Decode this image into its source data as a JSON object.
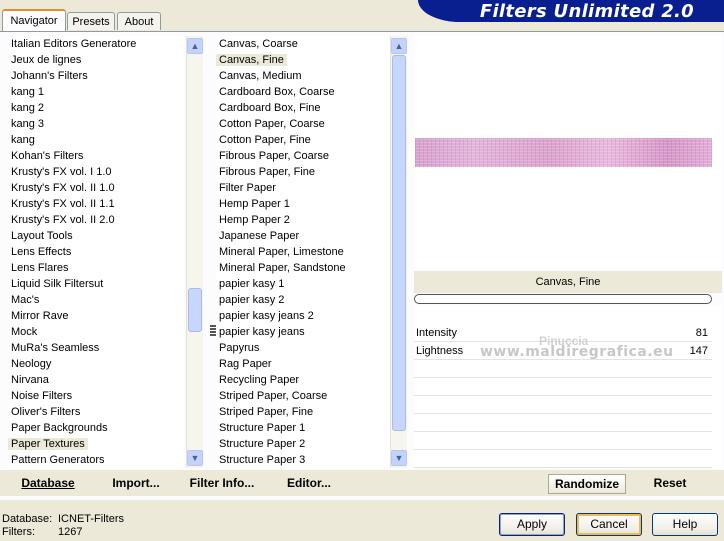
{
  "tabs": [
    {
      "label": "Navigator"
    },
    {
      "label": "Presets"
    },
    {
      "label": "About"
    }
  ],
  "banner": {
    "title": "Filters Unlimited 2.0"
  },
  "categories": {
    "items": [
      "Italian Editors Generatore",
      "Jeux de lignes",
      "Johann's Filters",
      "kang 1",
      "kang 2",
      "kang 3",
      "kang",
      "Kohan's Filters",
      "Krusty's FX vol. I 1.0",
      "Krusty's FX vol. II 1.0",
      "Krusty's FX vol. II 1.1",
      "Krusty's FX vol. II 2.0",
      "Layout Tools",
      "Lens Effects",
      "Lens Flares",
      "Liquid Silk Filtersut",
      "Mac's",
      "Mirror Rave",
      "Mock",
      "MuRa's Seamless",
      "Neology",
      "Nirvana",
      "Noise Filters",
      "Oliver's Filters",
      "Paper Backgrounds",
      "Paper Textures",
      "Pattern Generators"
    ],
    "selected_index": 25
  },
  "filters": {
    "items": [
      "Canvas, Coarse",
      "Canvas, Fine",
      "Canvas, Medium",
      "Cardboard Box, Coarse",
      "Cardboard Box, Fine",
      "Cotton Paper, Coarse",
      "Cotton Paper, Fine",
      "Fibrous Paper, Coarse",
      "Fibrous Paper, Fine",
      "Filter Paper",
      "Hemp Paper 1",
      "Hemp Paper 2",
      "Japanese Paper",
      "Mineral Paper, Limestone",
      "Mineral Paper, Sandstone",
      "papier kasy 1",
      "papier kasy 2",
      "papier kasy jeans 2",
      "papier kasy jeans",
      "Papyrus",
      "Rag Paper",
      "Recycling Paper",
      "Striped Paper, Coarse",
      "Striped Paper, Fine",
      "Structure Paper 1",
      "Structure Paper 2",
      "Structure Paper 3"
    ],
    "selected_index": 1
  },
  "toolbar": {
    "database": "Database",
    "import_pre": "Import...",
    "filter_info": "Filter Info...",
    "editor": "Editor...",
    "randomize": "Randomize",
    "reset": "Reset"
  },
  "preview": {
    "filter_name": "Canvas, Fine",
    "progress": 0
  },
  "params": [
    {
      "name": "Intensity",
      "value": "81"
    },
    {
      "name": "Lightness",
      "value": "147"
    }
  ],
  "watermark": {
    "line1": "Pinuccia",
    "line2": "www.maldiregrafica.eu"
  },
  "footer": {
    "database_label": "Database:",
    "database_value": "ICNET-Filters",
    "filters_label": "Filters:",
    "filters_value": "1267",
    "apply": "Apply",
    "cancel": "Cancel",
    "help": "Help"
  }
}
